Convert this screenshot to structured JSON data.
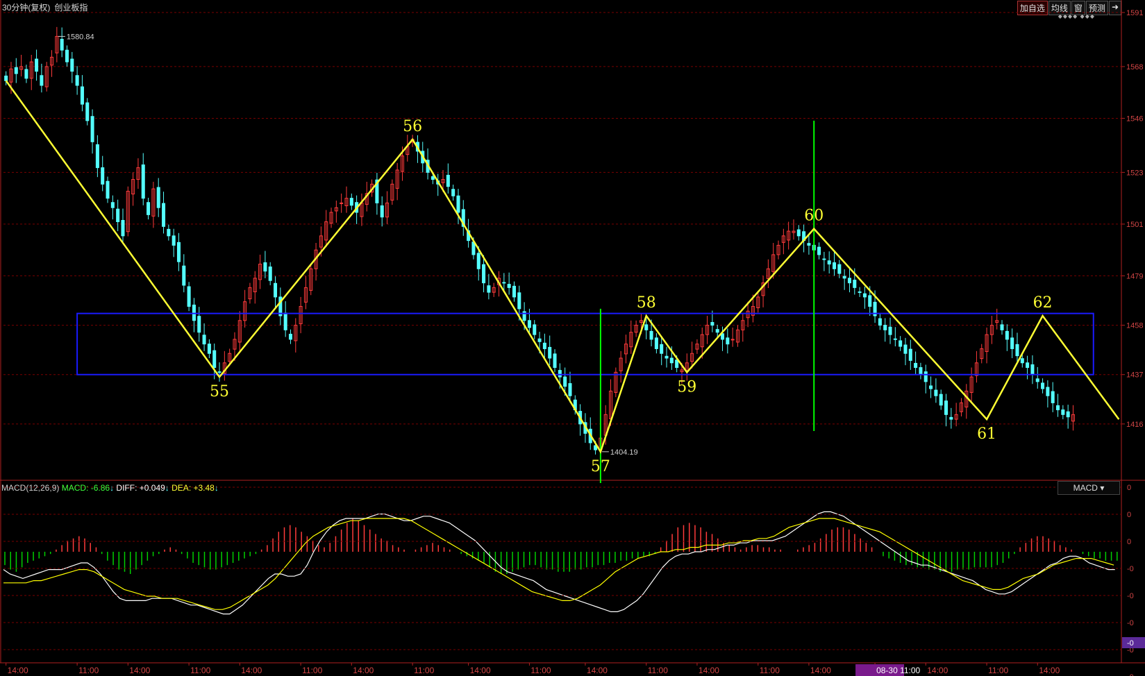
{
  "header": {
    "period": "30分钟(复权)",
    "name": "创业板指",
    "buttons": [
      "加自选",
      "均线",
      "窗",
      "预测"
    ],
    "exit_icon": "exit-icon",
    "diamonds": "◆◆◆◆  ◆◆◆"
  },
  "macd_header": {
    "label": "MACD(12,26,9)",
    "macd": "MACD: -6.86",
    "diff": "DIFF: +0.049",
    "dea": "DEA: +3.48",
    "selector": "MACD",
    "arrow": "↓"
  },
  "colors": {
    "up": "#ff3b3b",
    "down": "#54ffff",
    "wave": "#ffff33",
    "box": "#1a1aff",
    "vline": "#00ff00",
    "grid": "#7a0000",
    "diff": "#ffffff",
    "dea": "#ffff00",
    "hist_pos": "#ff3b3b",
    "hist_neg": "#00d000"
  },
  "chart_data": {
    "type": "candlestick",
    "y_axis_labels": [
      "1591",
      "1568",
      "1546",
      "1523",
      "1501",
      "1479",
      "1458",
      "1437",
      "1416"
    ],
    "ylim": [
      1395,
      1591
    ],
    "annotations": {
      "high": "1580.84",
      "low": "1404.19"
    },
    "wave_points": [
      {
        "label": "",
        "i": 0,
        "v": 1562
      },
      {
        "label": "55",
        "i": 42,
        "v": 1436
      },
      {
        "label": "56",
        "i": 80,
        "v": 1537
      },
      {
        "label": "57",
        "i": 117,
        "v": 1404.19
      },
      {
        "label": "58",
        "i": 126,
        "v": 1462
      },
      {
        "label": "59",
        "i": 134,
        "v": 1438
      },
      {
        "label": "60",
        "i": 159,
        "v": 1499
      },
      {
        "label": "61",
        "i": 193,
        "v": 1418
      },
      {
        "label": "62",
        "i": 204,
        "v": 1462
      },
      {
        "label": "",
        "i": 219,
        "v": 1418
      }
    ],
    "box": {
      "i_start": 14,
      "i_end": 214,
      "v_top": 1463,
      "v_bottom": 1437
    },
    "vertical_markers": [
      117,
      159
    ],
    "candles": {
      "count": 220,
      "series": [
        1562,
        1567,
        1565,
        1568,
        1563,
        1570,
        1566,
        1560,
        1568,
        1572,
        1580.84,
        1575,
        1570,
        1566,
        1560,
        1552,
        1545,
        1536,
        1525,
        1518,
        1512,
        1508,
        1502,
        1496,
        1515,
        1520,
        1525,
        1512,
        1505,
        1516,
        1508,
        1500,
        1496,
        1492,
        1485,
        1475,
        1466,
        1460,
        1455,
        1450,
        1446,
        1440,
        1438,
        1442,
        1446,
        1452,
        1460,
        1468,
        1474,
        1478,
        1484,
        1481,
        1477,
        1470,
        1462,
        1456,
        1452,
        1458,
        1466,
        1474,
        1482,
        1490,
        1496,
        1502,
        1506,
        1508,
        1510,
        1512,
        1509,
        1506,
        1510,
        1514,
        1518,
        1510,
        1504,
        1510,
        1518,
        1524,
        1530,
        1534,
        1537,
        1532,
        1527,
        1523,
        1520,
        1518,
        1520,
        1517,
        1513,
        1506,
        1500,
        1494,
        1488,
        1482,
        1476,
        1472,
        1474,
        1478,
        1476,
        1474,
        1470,
        1465,
        1460,
        1457,
        1454,
        1451,
        1448,
        1444,
        1440,
        1436,
        1432,
        1428,
        1422,
        1416,
        1412,
        1408,
        1405,
        1410,
        1420,
        1430,
        1438,
        1444,
        1450,
        1455,
        1458,
        1460,
        1456,
        1452,
        1448,
        1446,
        1444,
        1442,
        1440,
        1439,
        1442,
        1446,
        1450,
        1454,
        1458,
        1458,
        1455,
        1452,
        1450,
        1452,
        1456,
        1460,
        1464,
        1466,
        1470,
        1476,
        1482,
        1488,
        1492,
        1496,
        1498,
        1498,
        1496,
        1494,
        1492,
        1490,
        1488,
        1486,
        1484,
        1482,
        1480,
        1478,
        1476,
        1474,
        1472,
        1470,
        1466,
        1462,
        1458,
        1456,
        1454,
        1452,
        1449,
        1446,
        1443,
        1440,
        1437,
        1434,
        1431,
        1428,
        1424,
        1420,
        1418,
        1420,
        1425,
        1430,
        1436,
        1442,
        1448,
        1454,
        1458,
        1460,
        1456,
        1452,
        1448,
        1445,
        1442,
        1440,
        1437,
        1434,
        1431,
        1428,
        1425,
        1422,
        1420,
        1419,
        1420
      ]
    },
    "macd": {
      "hist": [
        -6,
        -8,
        -9,
        -7,
        -5,
        -4,
        -3,
        -2,
        -1,
        1,
        3,
        5,
        6,
        7,
        6,
        4,
        2,
        -1,
        -4,
        -6,
        -8,
        -9,
        -10,
        -8,
        -6,
        -4,
        -2,
        -1,
        1,
        2,
        1,
        -1,
        -3,
        -5,
        -6,
        -7,
        -8,
        -8,
        -7,
        -6,
        -5,
        -4,
        -3,
        -2,
        -1,
        1,
        3,
        6,
        9,
        11,
        12,
        11,
        9,
        7,
        5,
        3,
        2,
        4,
        7,
        10,
        13,
        15,
        14,
        12,
        10,
        8,
        6,
        5,
        3,
        2,
        1,
        0,
        1,
        2,
        3,
        4,
        3,
        2,
        1,
        0,
        -1,
        -2,
        -3,
        -4,
        -5,
        -7,
        -9,
        -10,
        -10,
        -9,
        -8,
        -7,
        -6,
        -6,
        -7,
        -8,
        -8,
        -9,
        -9,
        -9,
        -8,
        -8,
        -7,
        -7,
        -6,
        -6,
        -5,
        -5,
        -4,
        -4,
        -3,
        -3,
        -2,
        -2,
        -1,
        2,
        5,
        8,
        11,
        12,
        13,
        12,
        11,
        9,
        8,
        6,
        4,
        3,
        2,
        1,
        2,
        3,
        3,
        2,
        2,
        1,
        1,
        0,
        0,
        1,
        2,
        3,
        4,
        6,
        8,
        10,
        11,
        11,
        10,
        8,
        6,
        4,
        2,
        0,
        -2,
        -3,
        -4,
        -5,
        -6,
        -6,
        -7,
        -7,
        -8,
        -8,
        -9,
        -9,
        -9,
        -8,
        -8,
        -8,
        -7,
        -7,
        -7,
        -7,
        -6,
        -5,
        -3,
        -1,
        2,
        4,
        6,
        7,
        7,
        6,
        5,
        3,
        2,
        1,
        0,
        -1,
        -2,
        -3,
        -3,
        -4,
        -4,
        -4
      ],
      "diff": [
        -8,
        -10,
        -11,
        -12,
        -11,
        -10,
        -9,
        -8,
        -8,
        -8,
        -7,
        -6,
        -5,
        -5,
        -7,
        -10,
        -14,
        -18,
        -21,
        -22,
        -22,
        -22,
        -22,
        -21,
        -21,
        -21,
        -21,
        -22,
        -23,
        -24,
        -24,
        -25,
        -26,
        -27,
        -28,
        -28,
        -26,
        -24,
        -21,
        -18,
        -15,
        -12,
        -10,
        -10,
        -11,
        -11,
        -10,
        -6,
        0,
        5,
        9,
        12,
        14,
        15,
        15,
        15,
        15,
        16,
        17,
        17,
        16,
        15,
        14,
        14,
        15,
        16,
        16,
        15,
        14,
        13,
        11,
        9,
        7,
        5,
        2,
        -1,
        -4,
        -7,
        -9,
        -10,
        -11,
        -12,
        -13,
        -15,
        -17,
        -18,
        -19,
        -20,
        -21,
        -22,
        -23,
        -24,
        -25,
        -26,
        -27,
        -27,
        -26,
        -24,
        -22,
        -19,
        -15,
        -11,
        -7,
        -4,
        -2,
        -1,
        -1,
        0,
        0,
        1,
        1,
        2,
        3,
        3,
        4,
        4,
        5,
        5,
        5,
        5,
        6,
        7,
        9,
        11,
        13,
        15,
        17,
        18,
        18,
        17,
        16,
        14,
        12,
        10,
        8,
        6,
        4,
        2,
        0,
        -2,
        -4,
        -5,
        -6,
        -6,
        -7,
        -8,
        -9,
        -10,
        -11,
        -12,
        -13,
        -15,
        -17,
        -18,
        -19,
        -19,
        -18,
        -16,
        -14,
        -12,
        -10,
        -8,
        -6,
        -5,
        -3,
        -2,
        -2,
        -3,
        -5,
        -6,
        -7,
        -8,
        -8
      ],
      "dea": [
        -14,
        -14,
        -14,
        -14,
        -13,
        -13,
        -12,
        -11,
        -10,
        -9,
        -8,
        -8,
        -9,
        -11,
        -13,
        -15,
        -17,
        -18,
        -19,
        -20,
        -20,
        -21,
        -21,
        -21,
        -22,
        -23,
        -24,
        -25,
        -26,
        -26,
        -25,
        -23,
        -21,
        -19,
        -17,
        -15,
        -12,
        -8,
        -4,
        0,
        4,
        7,
        9,
        11,
        12,
        13,
        14,
        14,
        15,
        15,
        15,
        15,
        15,
        15,
        14,
        12,
        10,
        8,
        6,
        4,
        2,
        0,
        -2,
        -4,
        -6,
        -8,
        -10,
        -12,
        -14,
        -16,
        -18,
        -19,
        -20,
        -21,
        -22,
        -22,
        -21,
        -19,
        -17,
        -15,
        -12,
        -9,
        -7,
        -5,
        -3,
        -2,
        -1,
        0,
        0,
        1,
        1,
        2,
        2,
        3,
        3,
        3,
        4,
        4,
        5,
        5,
        6,
        6,
        7,
        9,
        11,
        12,
        13,
        14,
        15,
        15,
        15,
        14,
        13,
        12,
        11,
        10,
        9,
        7,
        5,
        3,
        1,
        -1,
        -3,
        -5,
        -7,
        -9,
        -11,
        -13,
        -14,
        -15,
        -16,
        -17,
        -17,
        -16,
        -14,
        -12,
        -11,
        -10,
        -8,
        -6,
        -5,
        -4,
        -3,
        -3,
        -3,
        -4,
        -5,
        -6
      ]
    },
    "macd_axis_labels": [
      "0",
      "0",
      "0",
      "-0",
      "-0",
      "-0",
      "-0",
      "-0"
    ],
    "macd_current": "-0",
    "time_labels": [
      {
        "t": "14:00",
        "i": 0
      },
      {
        "t": "11:00",
        "i": 14
      },
      {
        "t": "14:00",
        "i": 24
      },
      {
        "t": "11:00",
        "i": 36
      },
      {
        "t": "14:00",
        "i": 46
      },
      {
        "t": "11:00",
        "i": 58
      },
      {
        "t": "14:00",
        "i": 68
      },
      {
        "t": "11:00",
        "i": 80
      },
      {
        "t": "14:00",
        "i": 91
      },
      {
        "t": "11:00",
        "i": 103
      },
      {
        "t": "14:00",
        "i": 114
      },
      {
        "t": "11:00",
        "i": 126
      },
      {
        "t": "14:00",
        "i": 136
      },
      {
        "t": "11:00",
        "i": 148
      },
      {
        "t": "14:00",
        "i": 158
      },
      {
        "t": "08-30 11:00",
        "i": 171,
        "hl": true
      },
      {
        "t": "14:00",
        "i": 181
      },
      {
        "t": "11:00",
        "i": 193
      },
      {
        "t": "14:00",
        "i": 203
      }
    ]
  }
}
